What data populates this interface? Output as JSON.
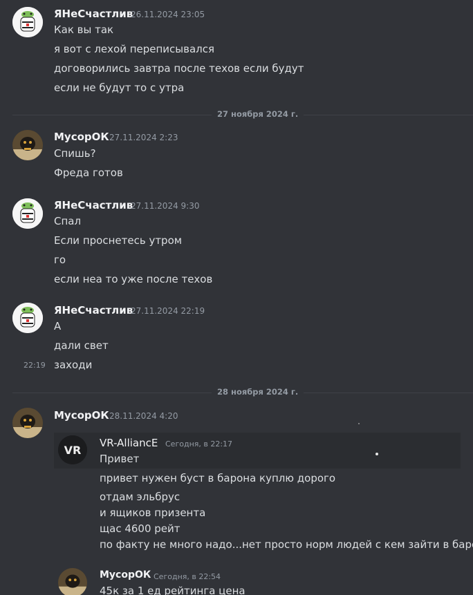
{
  "messages": [
    {
      "author": "ЯНеСчастлив",
      "timestamp": "26.11.2024 23:05",
      "lines": [
        "Как вы так",
        "я вот с лехой переписывался",
        "договорились завтра после техов если будут",
        "если не будут то с утра"
      ]
    },
    {
      "author": "МусорОК",
      "timestamp": "27.11.2024 2:23",
      "lines": [
        "Спишь?",
        "Фреда готов"
      ]
    },
    {
      "author": "ЯНеСчастлив",
      "timestamp": "27.11.2024 9:30",
      "lines": [
        "Спал",
        "Если проснетесь утром",
        "го",
        "если неа то уже после техов"
      ]
    },
    {
      "author": "ЯНеСчастлив",
      "timestamp": "27.11.2024 22:19",
      "lines": [
        "А",
        "дали свет",
        "заходи"
      ],
      "hover_time": "22:19"
    },
    {
      "author": "МусорОК",
      "timestamp": "28.11.2024 4:20",
      "lines": []
    }
  ],
  "dividers": [
    "27 ноября 2024 г.",
    "28 ноября 2024 г."
  ],
  "screenshot": {
    "logo_text": "VR",
    "first": {
      "author": "VR-AlliancE",
      "timestamp": "Сегодня, в 22:17",
      "lines": [
        "Привет",
        "привет нужен буст в барона куплю дорого",
        "отдам эльбрус",
        "и ящиков призента",
        "щас 4600 рейт",
        "по факту не много надо...нет просто норм людей с кем зайти в барона"
      ]
    },
    "second": {
      "author": "МусорОК",
      "timestamp": "Сегодня, в 22:54",
      "lines": [
        "45к за 1 ед рейтинга цена"
      ]
    }
  }
}
